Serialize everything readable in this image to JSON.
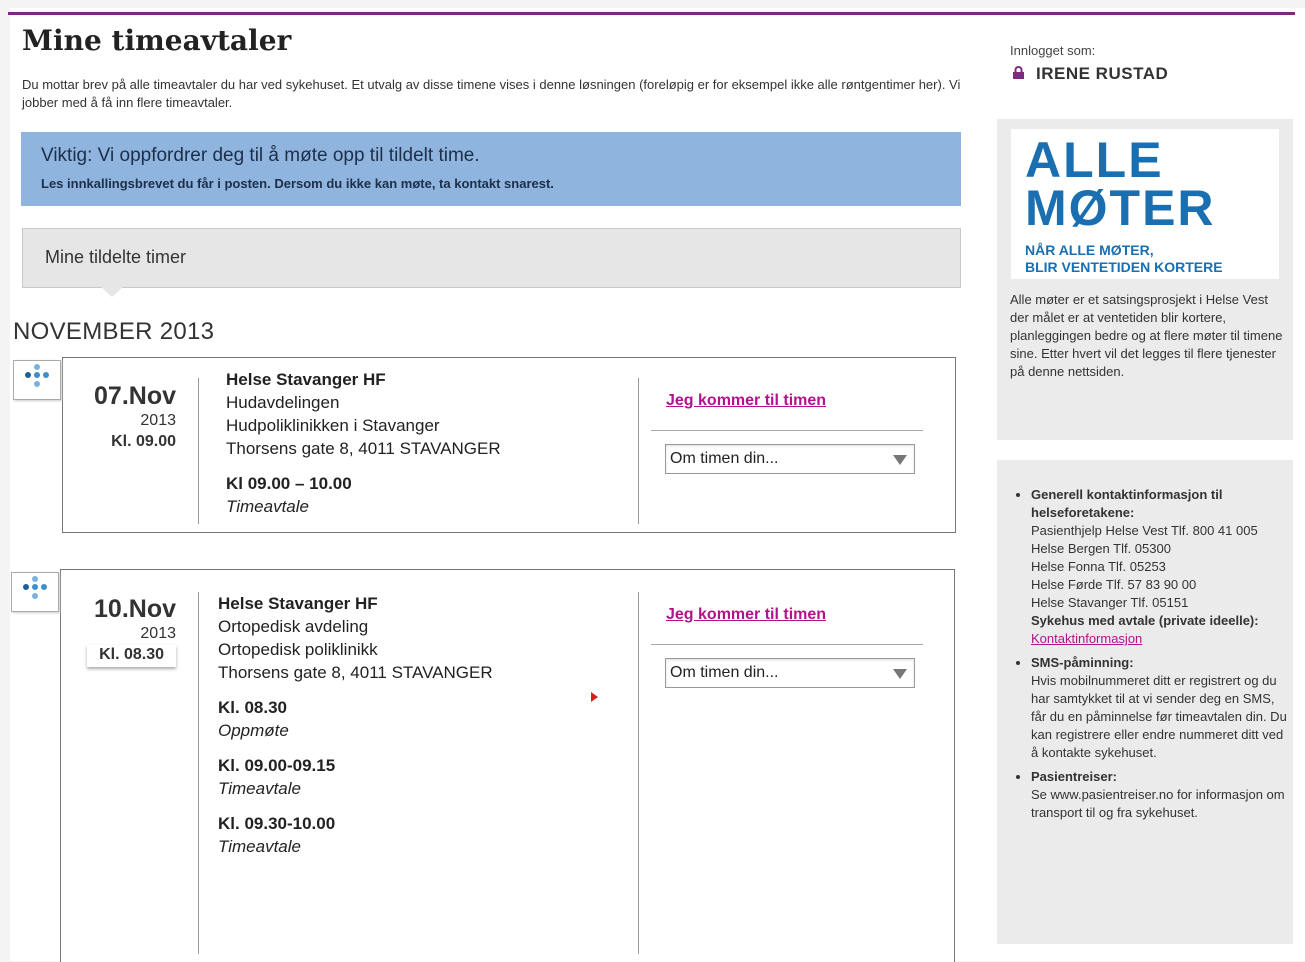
{
  "header": {
    "title": "Mine timeavtaler",
    "intro": "Du mottar brev på alle timeavtaler du har ved sykehuset. Et utvalg av disse timene vises i denne løsningen (foreløpig er for eksempel ikke alle røntgentimer her). Vi jobber med å få inn flere timeavtaler."
  },
  "alert": {
    "title": "Viktig: Vi oppfordrer deg til å møte opp til tildelt time.",
    "text": "Les innkallingsbrevet du får i posten. Dersom du ikke kan møte, ta kontakt snarest."
  },
  "tab": {
    "label": "Mine tildelte timer"
  },
  "month": "NOVEMBER 2013",
  "appointments": [
    {
      "day": "07.Nov",
      "year": "2013",
      "time": "Kl. 09.00",
      "hospital": "Helse Stavanger HF",
      "department": "Hudavdelingen",
      "clinic": "Hudpoliklinikken  i Stavanger",
      "address": "Thorsens gate 8, 4011 STAVANGER",
      "slots": [
        {
          "time": "Kl 09.00 – 10.00",
          "type": "Timeavtale"
        }
      ],
      "confirm_link": "Jeg kommer til timen",
      "select_label": "Om timen din..."
    },
    {
      "day": "10.Nov",
      "year": "2013",
      "time": "Kl. 08.30",
      "hospital": "Helse Stavanger HF",
      "department": "Ortopedisk avdeling",
      "clinic": "Ortopedisk poliklinikk",
      "address": "Thorsens gate 8, 4011 STAVANGER",
      "slots": [
        {
          "time": "Kl. 08.30",
          "type": "Oppmøte"
        },
        {
          "time": "Kl. 09.00-09.15",
          "type": "Timeavtale"
        },
        {
          "time": "Kl. 09.30-10.00",
          "type": "Timeavtale"
        }
      ],
      "confirm_link": "Jeg kommer til timen",
      "select_label": "Om timen din..."
    }
  ],
  "user": {
    "label": "Innlogget som:",
    "name": "IRENE RUSTAD"
  },
  "sidebar": {
    "logo_line1": "ALLE",
    "logo_line2": "MØTER",
    "logo_sub1": "NÅR ALLE MØTER,",
    "logo_sub2": "BLIR VENTETIDEN KORTERE",
    "description": "Alle møter er et satsingsprosjekt i Helse Vest der målet er at ventetiden blir kortere, planleggingen bedre og at flere møter til timene sine. Etter hvert vil det legges til flere tjenester på denne nettsiden.",
    "contact_head": "Generell kontaktinformasjon til helseforetakene:",
    "contact_lines": [
      "Pasienthjelp Helse Vest Tlf. 800 41 005",
      "Helse Bergen Tlf. 05300",
      "Helse Fonna Tlf. 05253",
      "Helse Førde Tlf. 57 83 90 00",
      "Helse Stavanger Tlf. 05151"
    ],
    "private_head": "Sykehus med avtale (private ideelle):",
    "private_link": "Kontaktinformasjon",
    "sms_head": "SMS-påminning:",
    "sms_text": "Hvis mobilnummeret ditt er registrert og du har samtykket til at vi sender deg en SMS, får du en påminnelse før timeavtalen din. Du kan registrere eller endre nummeret ditt ved å kontakte sykehuset.",
    "travel_head": "Pasientreiser:",
    "travel_text": "Se www.pasientreiser.no for informasjon om transport til og fra sykehuset."
  },
  "colors": {
    "accent_purple": "#7b2a7e",
    "link_magenta": "#b3128a",
    "alert_blue": "#8fb4dd",
    "logo_blue": "#1a6fb0"
  }
}
